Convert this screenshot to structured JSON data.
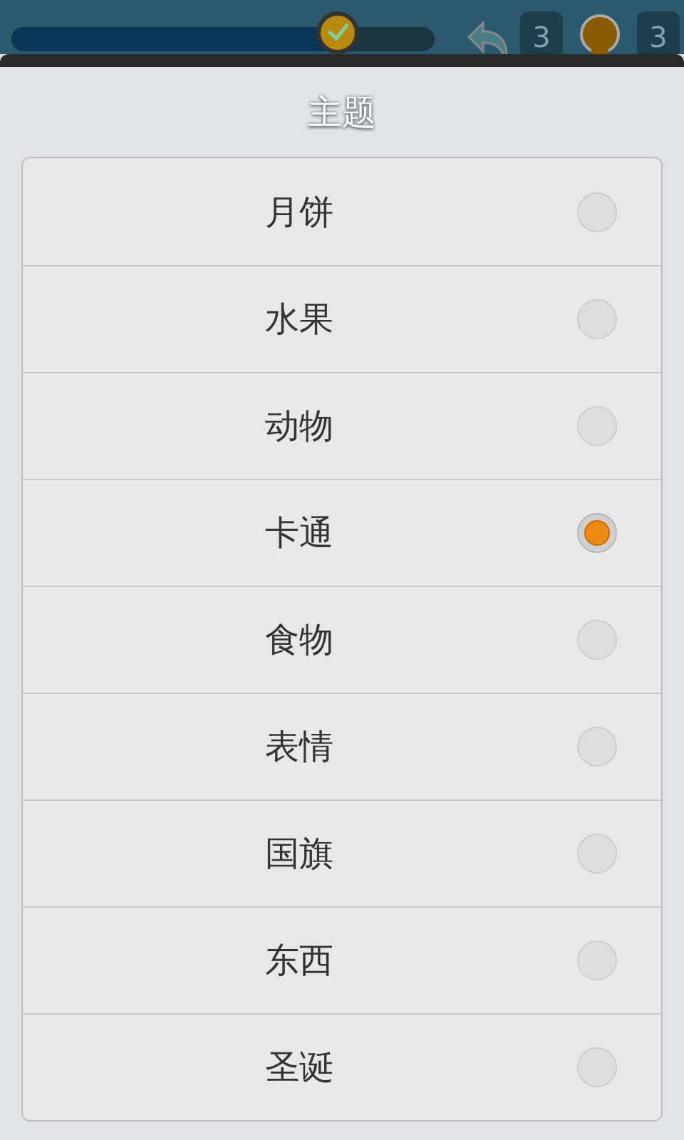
{
  "game_bar": {
    "progress": {
      "level": 0.77
    },
    "undo_count": "3",
    "hint_count": "3"
  },
  "dialog": {
    "title": "主题",
    "options": [
      {
        "label": "月饼",
        "selected": false
      },
      {
        "label": "水果",
        "selected": false
      },
      {
        "label": "动物",
        "selected": false
      },
      {
        "label": "卡通",
        "selected": true
      },
      {
        "label": "食物",
        "selected": false
      },
      {
        "label": "表情",
        "selected": false
      },
      {
        "label": "国旗",
        "selected": false
      },
      {
        "label": "东西",
        "selected": false
      },
      {
        "label": "圣诞",
        "selected": false
      }
    ]
  }
}
